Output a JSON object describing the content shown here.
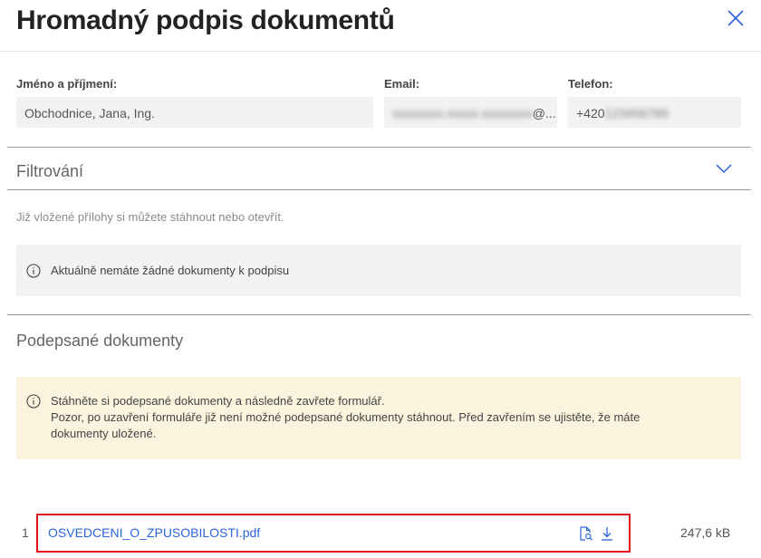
{
  "dialog": {
    "title": "Hromadný podpis dokumentů",
    "close_icon": "close-icon"
  },
  "contact": {
    "name_label": "Jméno a příjmení:",
    "name_value": "Obchodnice, Jana, Ing.",
    "email_label": "Email:",
    "email_value_visible": "@...",
    "phone_label": "Telefon:",
    "phone_value_visible": "+420"
  },
  "filter": {
    "title": "Filtrování",
    "toggle_icon": "chevron-down-icon"
  },
  "attachments": {
    "hint": "Již vložené přílohy si můžete stáhnout nebo otevřít.",
    "empty_message": "Aktuálně nemáte žádné dokumenty k podpisu",
    "info_icon": "info-icon"
  },
  "signed": {
    "title": "Podepsané dokumenty",
    "notice_lines": [
      "Stáhněte si podepsané dokumenty a následně zavřete formulář.",
      "Pozor, po uzavření formuláře již není možné podepsané dokumenty stáhnout. Před zavřením se ujistěte, že máte",
      "dokumenty uložené."
    ],
    "files": [
      {
        "index": "1",
        "name": "OSVEDCENI_O_ZPUSOBILOSTI.pdf",
        "size": "247,6 kB",
        "actions": [
          "document-search-icon",
          "download-icon"
        ]
      }
    ]
  },
  "colors": {
    "link": "#2b63d9",
    "notice_background": "#fbf3de",
    "field_background": "#f2f2f2",
    "highlight_border": "#e0101a"
  }
}
